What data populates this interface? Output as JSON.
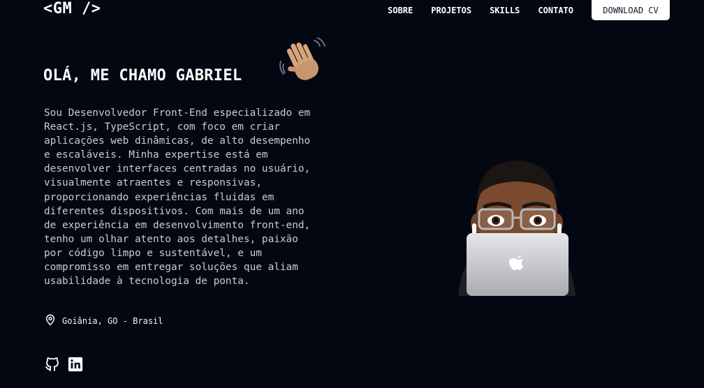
{
  "header": {
    "logo": "<GM />",
    "nav": [
      {
        "label": "SOBRE",
        "name": "nav-sobre"
      },
      {
        "label": "PROJETOS",
        "name": "nav-projetos"
      },
      {
        "label": "SKILLS",
        "name": "nav-skills"
      },
      {
        "label": "CONTATO",
        "name": "nav-contato"
      }
    ],
    "download_label": "DOWNLOAD CV"
  },
  "hero": {
    "greeting": "OLÁ, ME CHAMO GABRIEL",
    "wave_icon": "waving-hand-icon",
    "bio_lines": [
      "Sou Desenvolvedor Front-End especializado em",
      "React.js, TypeScript, com foco em criar",
      "aplicações web dinâmicas, de alto desempenho",
      "e escaláveis. Minha expertise está em",
      "desenvolver interfaces centradas no usuário,",
      "visualmente atraentes e responsivas,",
      "proporcionando experiências fluidas em",
      "diferentes dispositivos. Com mais de um ano",
      "de experiência em desenvolvimento front-end,",
      "tenho um olhar atento aos detalhes, paixão",
      "por código limpo e sustentável, e um",
      "compromisso em entregar soluções que aliam",
      "usabilidade à tecnologia de ponta."
    ],
    "location": "Goiânia, GO - Brasil",
    "location_icon": "map-pin-icon",
    "socials": [
      {
        "icon": "github-icon"
      },
      {
        "icon": "linkedin-icon"
      }
    ],
    "avatar_icon": "memoji-laptop-avatar"
  },
  "colors": {
    "background": "#030712",
    "text": "#f3f4f6",
    "muted_text": "#c8ccd3",
    "button_bg": "#ffffff",
    "button_text": "#111827"
  }
}
